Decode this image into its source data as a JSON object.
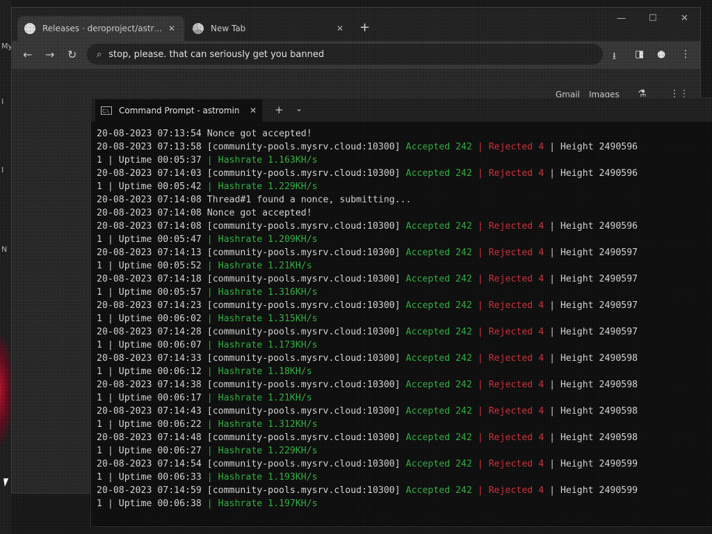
{
  "desktop": {
    "letters": [
      "My",
      "I",
      "I",
      "N"
    ]
  },
  "browser": {
    "tabs": [
      {
        "label": "Releases · deroproject/astrobwt-m…",
        "icon": "github-icon"
      },
      {
        "label": "New Tab",
        "icon": "chrome-icon"
      }
    ],
    "omnibox": "stop, please. that can seriously get you banned",
    "links": {
      "gmail": "Gmail",
      "images": "Images"
    }
  },
  "terminal": {
    "tab_title": "Command Prompt - astromin",
    "lines": [
      [
        {
          "t": "20-08-2023 07:13:54 Nonce got accepted!"
        }
      ],
      [
        {
          "t": "20-08-2023 07:13:58 [community-pools.mysrv.cloud:10300] "
        },
        {
          "t": "Accepted 242",
          "c": "g"
        },
        {
          "t": " | ",
          "c": "r"
        },
        {
          "t": "Rejected 4",
          "c": "r"
        },
        {
          "t": " | Height 2490596"
        }
      ],
      [
        {
          "t": "1 | Uptime 00:05:37 "
        },
        {
          "t": "| Hashrate 1.163KH/s",
          "c": "g"
        }
      ],
      [
        {
          "t": "20-08-2023 07:14:03 [community-pools.mysrv.cloud:10300] "
        },
        {
          "t": "Accepted 242",
          "c": "g"
        },
        {
          "t": " | ",
          "c": "r"
        },
        {
          "t": "Rejected 4",
          "c": "r"
        },
        {
          "t": " | Height 2490596"
        }
      ],
      [
        {
          "t": "1 | Uptime 00:05:42 "
        },
        {
          "t": "| Hashrate 1.229KH/s",
          "c": "g"
        }
      ],
      [
        {
          "t": "20-08-2023 07:14:08 Thread#1 found a nonce, submitting..."
        }
      ],
      [
        {
          "t": "20-08-2023 07:14:08 Nonce got accepted!"
        }
      ],
      [
        {
          "t": "20-08-2023 07:14:08 [community-pools.mysrv.cloud:10300] "
        },
        {
          "t": "Accepted 242",
          "c": "g"
        },
        {
          "t": " | ",
          "c": "r"
        },
        {
          "t": "Rejected 4",
          "c": "r"
        },
        {
          "t": " | Height 2490596"
        }
      ],
      [
        {
          "t": "1 | Uptime 00:05:47 "
        },
        {
          "t": "| Hashrate 1.209KH/s",
          "c": "g"
        }
      ],
      [
        {
          "t": "20-08-2023 07:14:13 [community-pools.mysrv.cloud:10300] "
        },
        {
          "t": "Accepted 242",
          "c": "g"
        },
        {
          "t": " | ",
          "c": "r"
        },
        {
          "t": "Rejected 4",
          "c": "r"
        },
        {
          "t": " | Height 2490597"
        }
      ],
      [
        {
          "t": "1 | Uptime 00:05:52 "
        },
        {
          "t": "| Hashrate 1.21KH/s",
          "c": "g"
        }
      ],
      [
        {
          "t": "20-08-2023 07:14:18 [community-pools.mysrv.cloud:10300] "
        },
        {
          "t": "Accepted 242",
          "c": "g"
        },
        {
          "t": " | ",
          "c": "r"
        },
        {
          "t": "Rejected 4",
          "c": "r"
        },
        {
          "t": " | Height 2490597"
        }
      ],
      [
        {
          "t": "1 | Uptime 00:05:57 "
        },
        {
          "t": "| Hashrate 1.316KH/s",
          "c": "g"
        }
      ],
      [
        {
          "t": "20-08-2023 07:14:23 [community-pools.mysrv.cloud:10300] "
        },
        {
          "t": "Accepted 242",
          "c": "g"
        },
        {
          "t": " | ",
          "c": "r"
        },
        {
          "t": "Rejected 4",
          "c": "r"
        },
        {
          "t": " | Height 2490597"
        }
      ],
      [
        {
          "t": "1 | Uptime 00:06:02 "
        },
        {
          "t": "| Hashrate 1.315KH/s",
          "c": "g"
        }
      ],
      [
        {
          "t": "20-08-2023 07:14:28 [community-pools.mysrv.cloud:10300] "
        },
        {
          "t": "Accepted 242",
          "c": "g"
        },
        {
          "t": " | ",
          "c": "r"
        },
        {
          "t": "Rejected 4",
          "c": "r"
        },
        {
          "t": " | Height 2490597"
        }
      ],
      [
        {
          "t": "1 | Uptime 00:06:07 "
        },
        {
          "t": "| Hashrate 1.173KH/s",
          "c": "g"
        }
      ],
      [
        {
          "t": "20-08-2023 07:14:33 [community-pools.mysrv.cloud:10300] "
        },
        {
          "t": "Accepted 242",
          "c": "g"
        },
        {
          "t": " | ",
          "c": "r"
        },
        {
          "t": "Rejected 4",
          "c": "r"
        },
        {
          "t": " | Height 2490598"
        }
      ],
      [
        {
          "t": "1 | Uptime 00:06:12 "
        },
        {
          "t": "| Hashrate 1.18KH/s",
          "c": "g"
        }
      ],
      [
        {
          "t": "20-08-2023 07:14:38 [community-pools.mysrv.cloud:10300] "
        },
        {
          "t": "Accepted 242",
          "c": "g"
        },
        {
          "t": " | ",
          "c": "r"
        },
        {
          "t": "Rejected 4",
          "c": "r"
        },
        {
          "t": " | Height 2490598"
        }
      ],
      [
        {
          "t": "1 | Uptime 00:06:17 "
        },
        {
          "t": "| Hashrate 1.21KH/s",
          "c": "g"
        }
      ],
      [
        {
          "t": "20-08-2023 07:14:43 [community-pools.mysrv.cloud:10300] "
        },
        {
          "t": "Accepted 242",
          "c": "g"
        },
        {
          "t": " | ",
          "c": "r"
        },
        {
          "t": "Rejected 4",
          "c": "r"
        },
        {
          "t": " | Height 2490598"
        }
      ],
      [
        {
          "t": "1 | Uptime 00:06:22 "
        },
        {
          "t": "| Hashrate 1.312KH/s",
          "c": "g"
        }
      ],
      [
        {
          "t": "20-08-2023 07:14:48 [community-pools.mysrv.cloud:10300] "
        },
        {
          "t": "Accepted 242",
          "c": "g"
        },
        {
          "t": " | ",
          "c": "r"
        },
        {
          "t": "Rejected 4",
          "c": "r"
        },
        {
          "t": " | Height 2490598"
        }
      ],
      [
        {
          "t": "1 | Uptime 00:06:27 "
        },
        {
          "t": "| Hashrate 1.229KH/s",
          "c": "g"
        }
      ],
      [
        {
          "t": "20-08-2023 07:14:54 [community-pools.mysrv.cloud:10300] "
        },
        {
          "t": "Accepted 242",
          "c": "g"
        },
        {
          "t": " | ",
          "c": "r"
        },
        {
          "t": "Rejected 4",
          "c": "r"
        },
        {
          "t": " | Height 2490599"
        }
      ],
      [
        {
          "t": "1 | Uptime 00:06:33 "
        },
        {
          "t": "| Hashrate 1.193KH/s",
          "c": "g"
        }
      ],
      [
        {
          "t": "20-08-2023 07:14:59 [community-pools.mysrv.cloud:10300] "
        },
        {
          "t": "Accepted 242",
          "c": "g"
        },
        {
          "t": " | ",
          "c": "r"
        },
        {
          "t": "Rejected 4",
          "c": "r"
        },
        {
          "t": " | Height 2490599"
        }
      ],
      [
        {
          "t": "1 | Uptime 00:06:38 "
        },
        {
          "t": "| Hashrate 1.197KH/s",
          "c": "g"
        }
      ]
    ]
  },
  "colors": {
    "accepted": "#2fb33f",
    "rejected": "#d32f3a",
    "terminal_bg": "#0c0c0c"
  }
}
